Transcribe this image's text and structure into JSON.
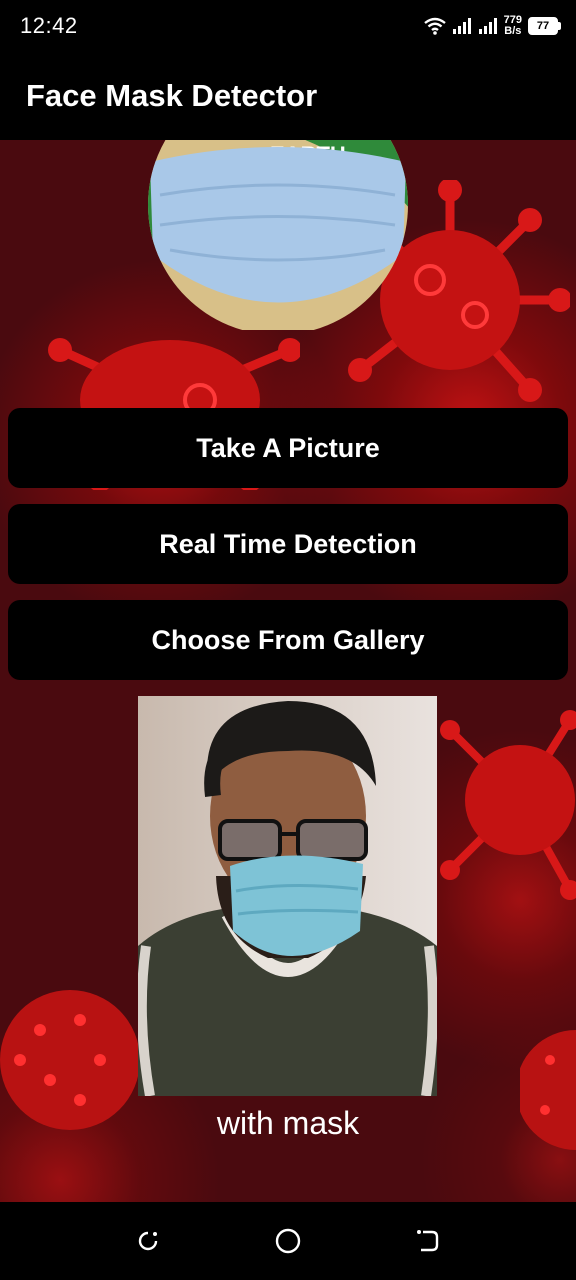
{
  "status_bar": {
    "time": "12:42",
    "net_speed_value": "779",
    "net_speed_unit": "B/s",
    "battery": "77",
    "icons": [
      "wifi-icon",
      "signal-icon",
      "signal-icon",
      "battery-icon"
    ]
  },
  "app_bar": {
    "title": "Face Mask Detector"
  },
  "logo": {
    "text": "EARTH",
    "icon": "face-mask-logo"
  },
  "actions": {
    "take_picture": "Take A Picture",
    "real_time": "Real Time Detection",
    "gallery": "Choose From Gallery"
  },
  "result": {
    "label": "with mask"
  },
  "nav_bar": {
    "icons": [
      "recents-icon",
      "home-icon",
      "back-icon"
    ]
  },
  "colors": {
    "background": "#4a0a0f",
    "virus_red": "#e01818",
    "button": "#000000",
    "text": "#ffffff"
  }
}
